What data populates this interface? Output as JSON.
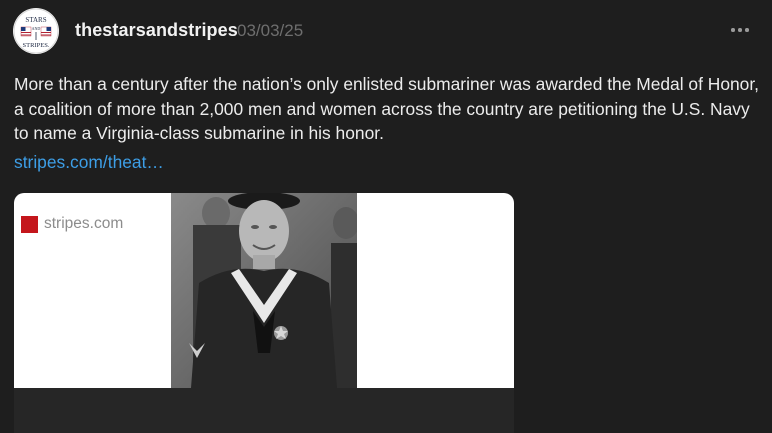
{
  "post": {
    "author": {
      "username": "thestarsandstripes",
      "avatar_icon": "stars-and-stripes-logo",
      "avatar_text": [
        "STARS",
        "AND",
        "STRIPES."
      ]
    },
    "date": "03/03/25",
    "menu_icon": "more-horizontal-icon",
    "text": "More than a century after the nation’s only enlisted submariner was awarded the Medal of Honor, a coalition of more than 2,000 men and women across the country are petitioning the U.S. Navy to name a Virginia-class submarine in his honor.",
    "link_text": "stripes.com/theat…",
    "link_preview": {
      "image_icon": "sailor-photo",
      "domain": "stripes.com",
      "favicon_icon": "stripes-favicon",
      "favicon_color": "#c4161c"
    }
  },
  "colors": {
    "background": "#1e1e1e",
    "text": "#ececec",
    "muted": "#6e6e6e",
    "link": "#3d9ee6",
    "card_footer": "#262626"
  }
}
